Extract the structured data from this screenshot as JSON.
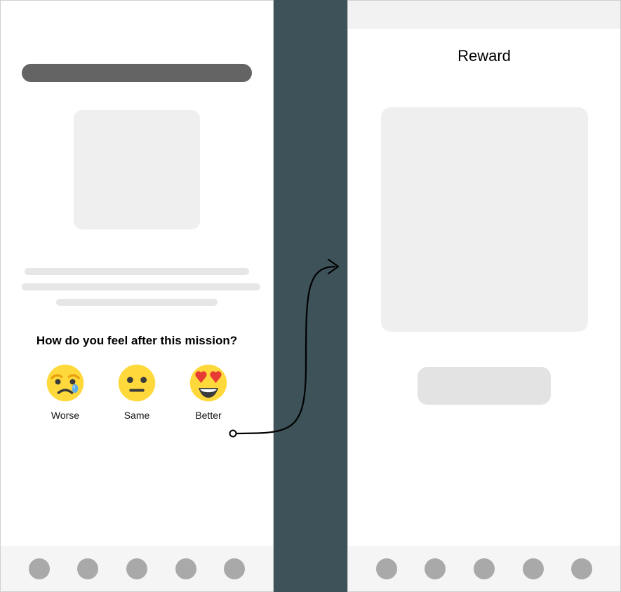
{
  "left": {
    "question": "How do you feel after this mission?",
    "options": [
      {
        "name": "worse",
        "label": "Worse"
      },
      {
        "name": "same",
        "label": "Same"
      },
      {
        "name": "better",
        "label": "Better"
      }
    ]
  },
  "right": {
    "title": "Reward"
  }
}
